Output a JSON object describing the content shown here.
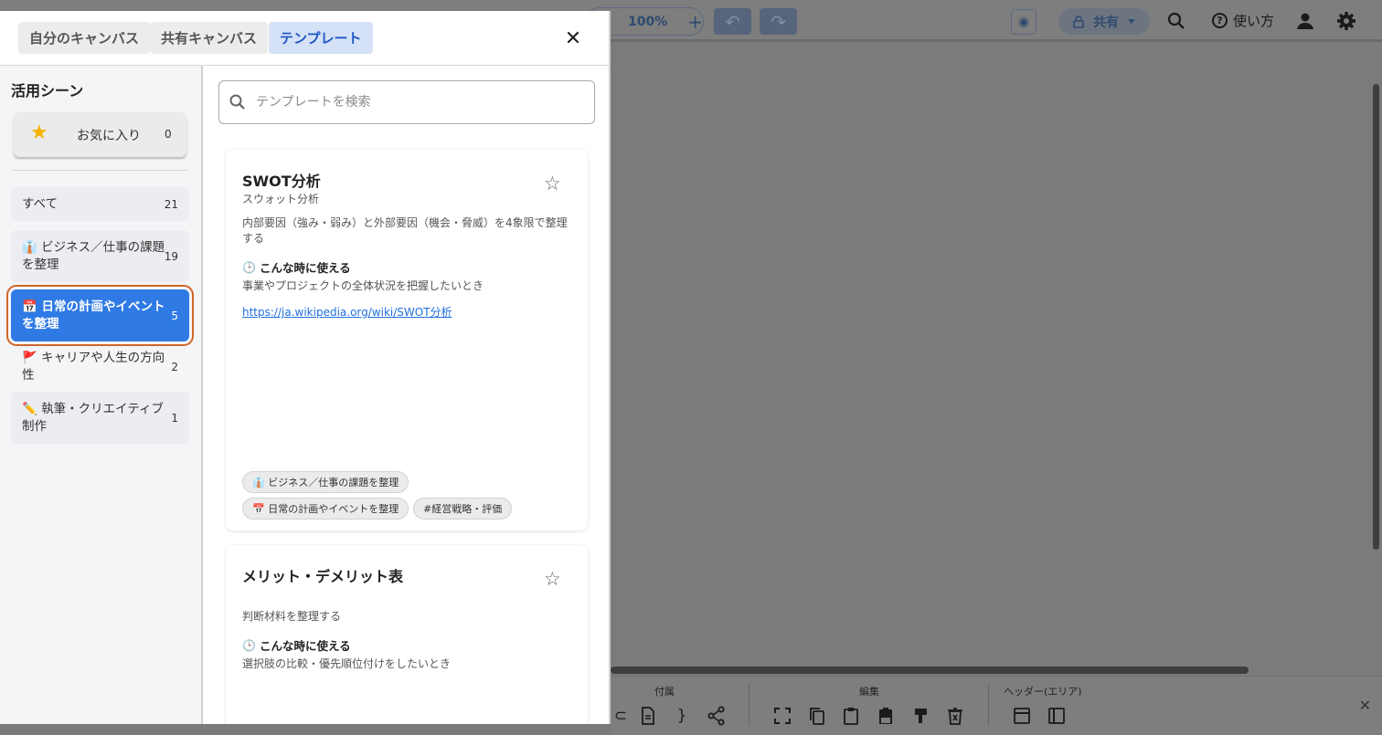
{
  "background": {
    "zoom_level": "100%",
    "zoom_plus": "+",
    "undo_icon": "↶",
    "redo_icon": "↷",
    "camera_icon": "◉",
    "share_label": "共有",
    "help_label": "使い方",
    "bottom_groups": [
      "付属",
      "編集",
      "ヘッダー(エリア)"
    ]
  },
  "tabs": [
    {
      "label": "自分のキャンバス",
      "active": false
    },
    {
      "label": "共有キャンバス",
      "active": false
    },
    {
      "label": "テンプレート",
      "active": true
    }
  ],
  "close_icon": "✕",
  "sidebar": {
    "title": "活用シーン",
    "favorites": {
      "icon": "★",
      "label": "お気に入り",
      "count": "0"
    },
    "items": [
      {
        "label": "すべて",
        "count": "21",
        "selected": false
      },
      {
        "label": "👔 ビジネス／仕事の課題を整理",
        "count": "19",
        "selected": false
      },
      {
        "label": "📅 日常の計画やイベントを整理",
        "count": "5",
        "selected": true
      },
      {
        "label": "🚩 キャリアや人生の方向性",
        "count": "2",
        "selected": false
      },
      {
        "label": "✏️ 執筆・クリエイティブ制作",
        "count": "1",
        "selected": false
      }
    ]
  },
  "search": {
    "placeholder": "テンプレートを検索",
    "value": ""
  },
  "templates": [
    {
      "title": "SWOT分析",
      "subtitle": "スウォット分析",
      "description": "内部要因（強み・弱み）と外部要因（機会・脅威）を4象限で整理する",
      "when_label": "こんな時に使える",
      "use_case": "事業やプロジェクトの全体状況を把握したいとき",
      "link": "https://ja.wikipedia.org/wiki/SWOT分析",
      "tags": [
        "👔 ビジネス／仕事の課題を整理",
        "📅 日常の計画やイベントを整理",
        "#経営戦略・評価"
      ]
    },
    {
      "title": "メリット・デメリット表",
      "subtitle": "",
      "description": "判断材料を整理する",
      "when_label": "こんな時に使える",
      "use_case": "選択肢の比較・優先順位付けをしたいとき",
      "link": "",
      "tags": []
    }
  ],
  "card_star_icon": "☆",
  "clock_icon": "🕒"
}
